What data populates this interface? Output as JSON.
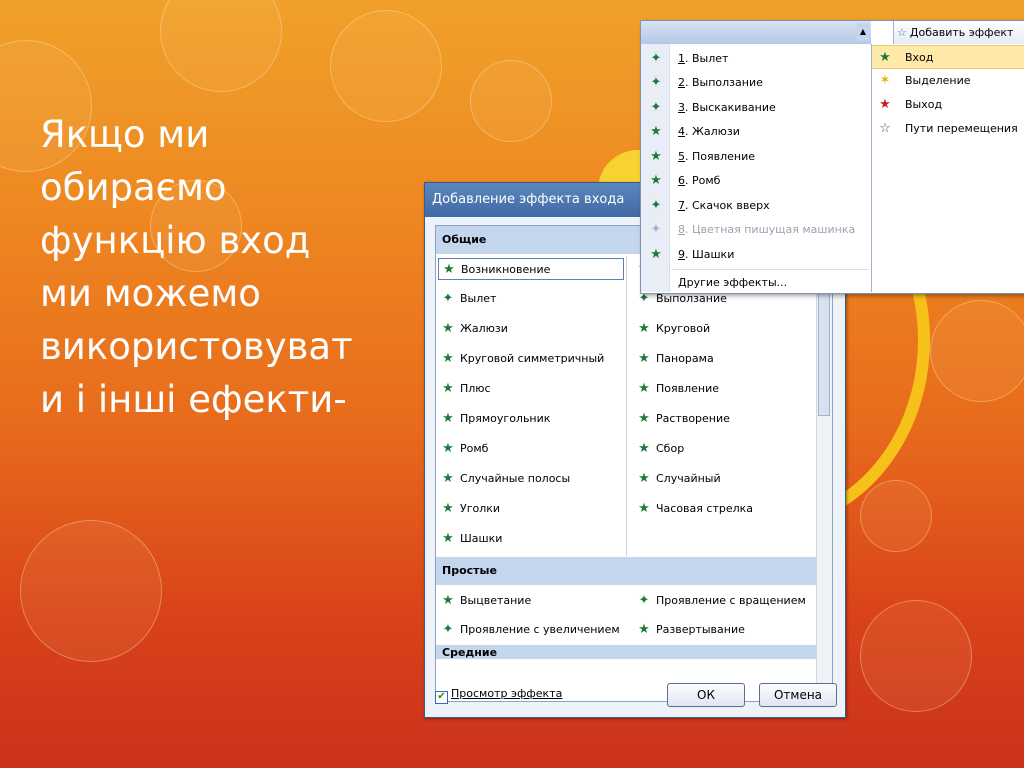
{
  "slide": {
    "text_lines": [
      "Якщо ми",
      "обираємо",
      "функцію вход",
      "ми можемо",
      "використовуват",
      "и і інші ефекти-"
    ]
  },
  "dialog": {
    "title": "Добавление эффекта входа",
    "sections": {
      "general": "Общие",
      "simple": "Простые",
      "medium": "Средние"
    },
    "general_left": [
      "Возникновение",
      "Вылет",
      "Жалюзи",
      "Круговой симметричный",
      "Плюс",
      "Прямоугольник",
      "Ромб",
      "Случайные полосы",
      "Уголки",
      "Шашки"
    ],
    "general_right": [
      "",
      "Выползание",
      "Круговой",
      "Панорама",
      "Появление",
      "Растворение",
      "Сбор",
      "Случайный",
      "Часовая стрелка"
    ],
    "simple_left": [
      "Выцветание",
      "Проявление с увеличением"
    ],
    "simple_right": [
      "Проявление с вращением",
      "Развертывание"
    ],
    "preview_label": "Просмотр эффекта",
    "preview_checked": true,
    "ok_label": "ОК",
    "cancel_label": "Отмена"
  },
  "menu": {
    "add_effect_label": "Добавить эффект",
    "submenu": [
      {
        "num": "1",
        "label": ". Вылет",
        "disabled": false
      },
      {
        "num": "2",
        "label": ". Выползание",
        "disabled": false
      },
      {
        "num": "3",
        "label": ". Выскакивание",
        "disabled": false
      },
      {
        "num": "4",
        "label": ". Жалюзи",
        "disabled": false
      },
      {
        "num": "5",
        "label": ". Появление",
        "disabled": false
      },
      {
        "num": "6",
        "label": ". Ромб",
        "disabled": false
      },
      {
        "num": "7",
        "label": ". Скачок вверх",
        "disabled": false
      },
      {
        "num": "8",
        "label": ". Цветная пишущая машинка",
        "disabled": true
      },
      {
        "num": "9",
        "label": ". Шашки",
        "disabled": false
      }
    ],
    "other_effects": "Другие эффекты...",
    "categories": [
      "Вход",
      "Выделение",
      "Выход",
      "Пути перемещения"
    ],
    "active_category": "Вход"
  },
  "colors": {
    "accent": "#3f6aa5",
    "highlight": "#ffe9a8",
    "icon_green": "#1c7a3a"
  }
}
